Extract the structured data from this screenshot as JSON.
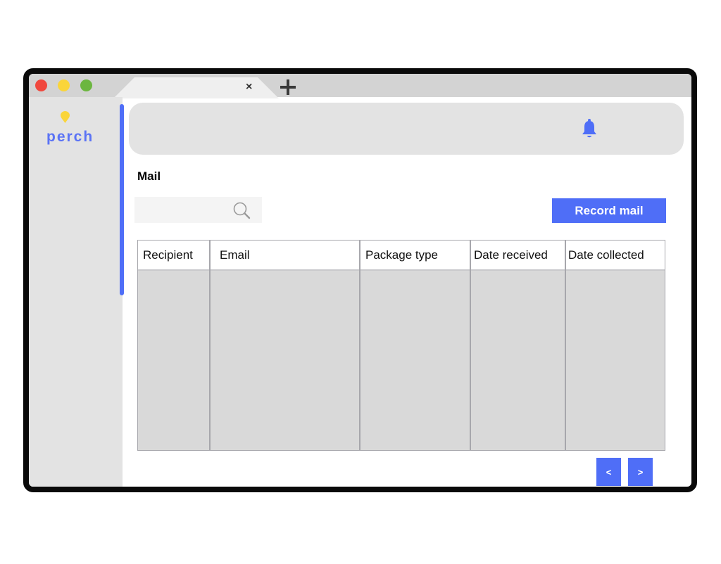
{
  "browser": {
    "tab": {
      "close_glyph": "×"
    },
    "window_controls": {
      "close": "#f0483e",
      "minimize": "#fad53a",
      "maximize": "#6cb63f"
    }
  },
  "sidebar": {
    "logo_text": "perch",
    "logo_icon": "location-pin-icon",
    "accent_color": "#5b73f5"
  },
  "header": {
    "notification_icon": "bell-icon"
  },
  "page": {
    "title": "Mail"
  },
  "search": {
    "value": "",
    "placeholder": "",
    "icon": "search-icon"
  },
  "toolbar": {
    "record_label": "Record mail"
  },
  "table": {
    "columns": [
      "Recipient",
      "Email",
      "Package type",
      "Date received",
      "Date collected"
    ],
    "rows": []
  },
  "pagination": {
    "prev_label": "<",
    "next_label": ">"
  },
  "colors": {
    "primary": "#4f6ef7",
    "panel": "#e3e3e3",
    "table_body": "#d9d9d9"
  }
}
